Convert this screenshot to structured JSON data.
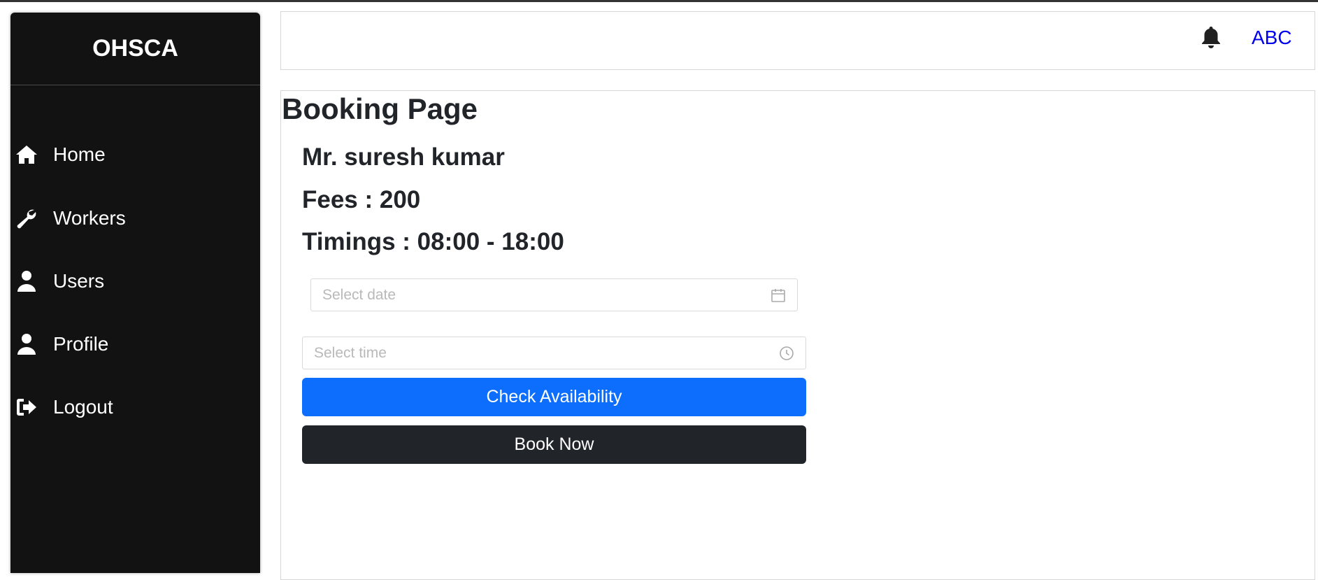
{
  "sidebar": {
    "brand": "OHSCA",
    "items": [
      {
        "label": "Home",
        "icon": "home-icon"
      },
      {
        "label": "Workers",
        "icon": "wrench-icon"
      },
      {
        "label": "Users",
        "icon": "user-icon"
      },
      {
        "label": "Profile",
        "icon": "user-icon"
      },
      {
        "label": "Logout",
        "icon": "logout-icon"
      }
    ]
  },
  "header": {
    "notification_icon": "bell-icon",
    "user_name": "ABC"
  },
  "main": {
    "title": "Booking Page",
    "worker_name": "Mr. suresh kumar",
    "fees": "Fees : 200",
    "timings": "Timings : 08:00 - 18:00",
    "date_placeholder": "Select date",
    "time_placeholder": "Select time",
    "check_button": "Check Availability",
    "book_button": "Book Now"
  },
  "colors": {
    "sidebar_bg": "#121212",
    "primary": "#0d6efd",
    "dark": "#212529",
    "link": "#0000ee"
  }
}
